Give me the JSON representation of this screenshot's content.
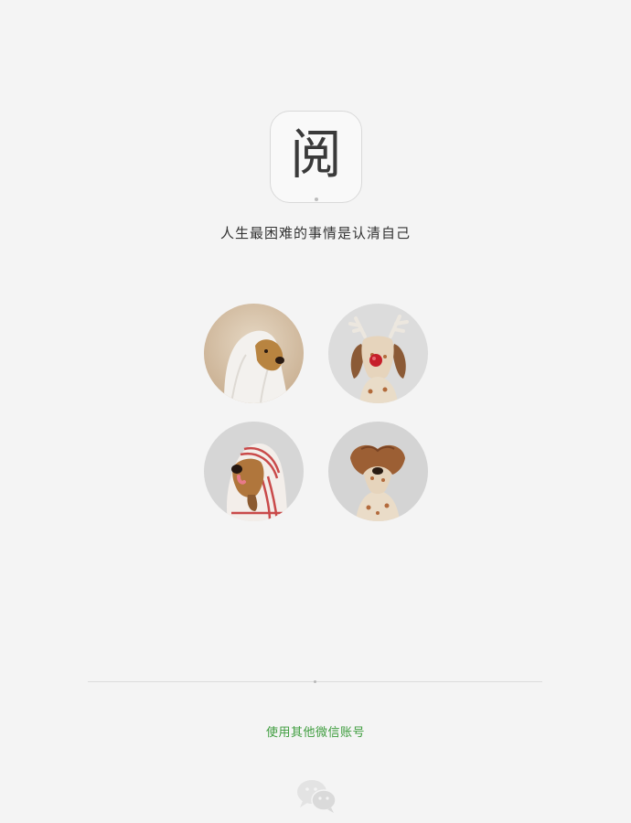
{
  "app": {
    "logo_char": "阅",
    "slogan": "人生最困难的事情是认清自己"
  },
  "accounts": [
    {
      "icon": "ghost-dog-avatar",
      "bg": "#d6c2a8"
    },
    {
      "icon": "reindeer-dog-avatar",
      "bg": "#d9d9d9"
    },
    {
      "icon": "hoodie-dog-avatar",
      "bg": "#d2d2d2"
    },
    {
      "icon": "brown-hat-dog-avatar",
      "bg": "#cfcfcf"
    }
  ],
  "footer": {
    "other_account_label": "使用其他微信账号",
    "wechat_icon": "wechat-icon"
  },
  "colors": {
    "background": "#f4f4f4",
    "accent_green": "#3e9d3e",
    "text": "#333333"
  }
}
